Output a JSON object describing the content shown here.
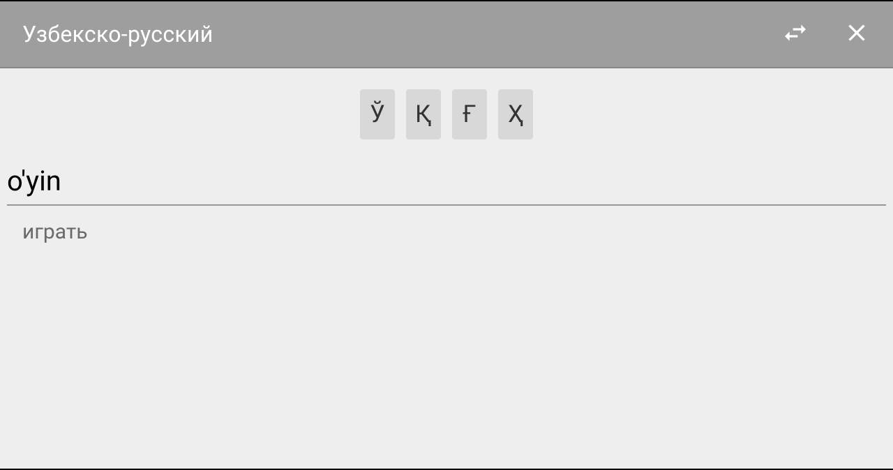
{
  "header": {
    "title": "Узбекско-русский"
  },
  "charButtons": {
    "0": "Ў",
    "1": "Қ",
    "2": "Ғ",
    "3": "Ҳ"
  },
  "search": {
    "value": "o'yin"
  },
  "results": {
    "0": "играть"
  }
}
